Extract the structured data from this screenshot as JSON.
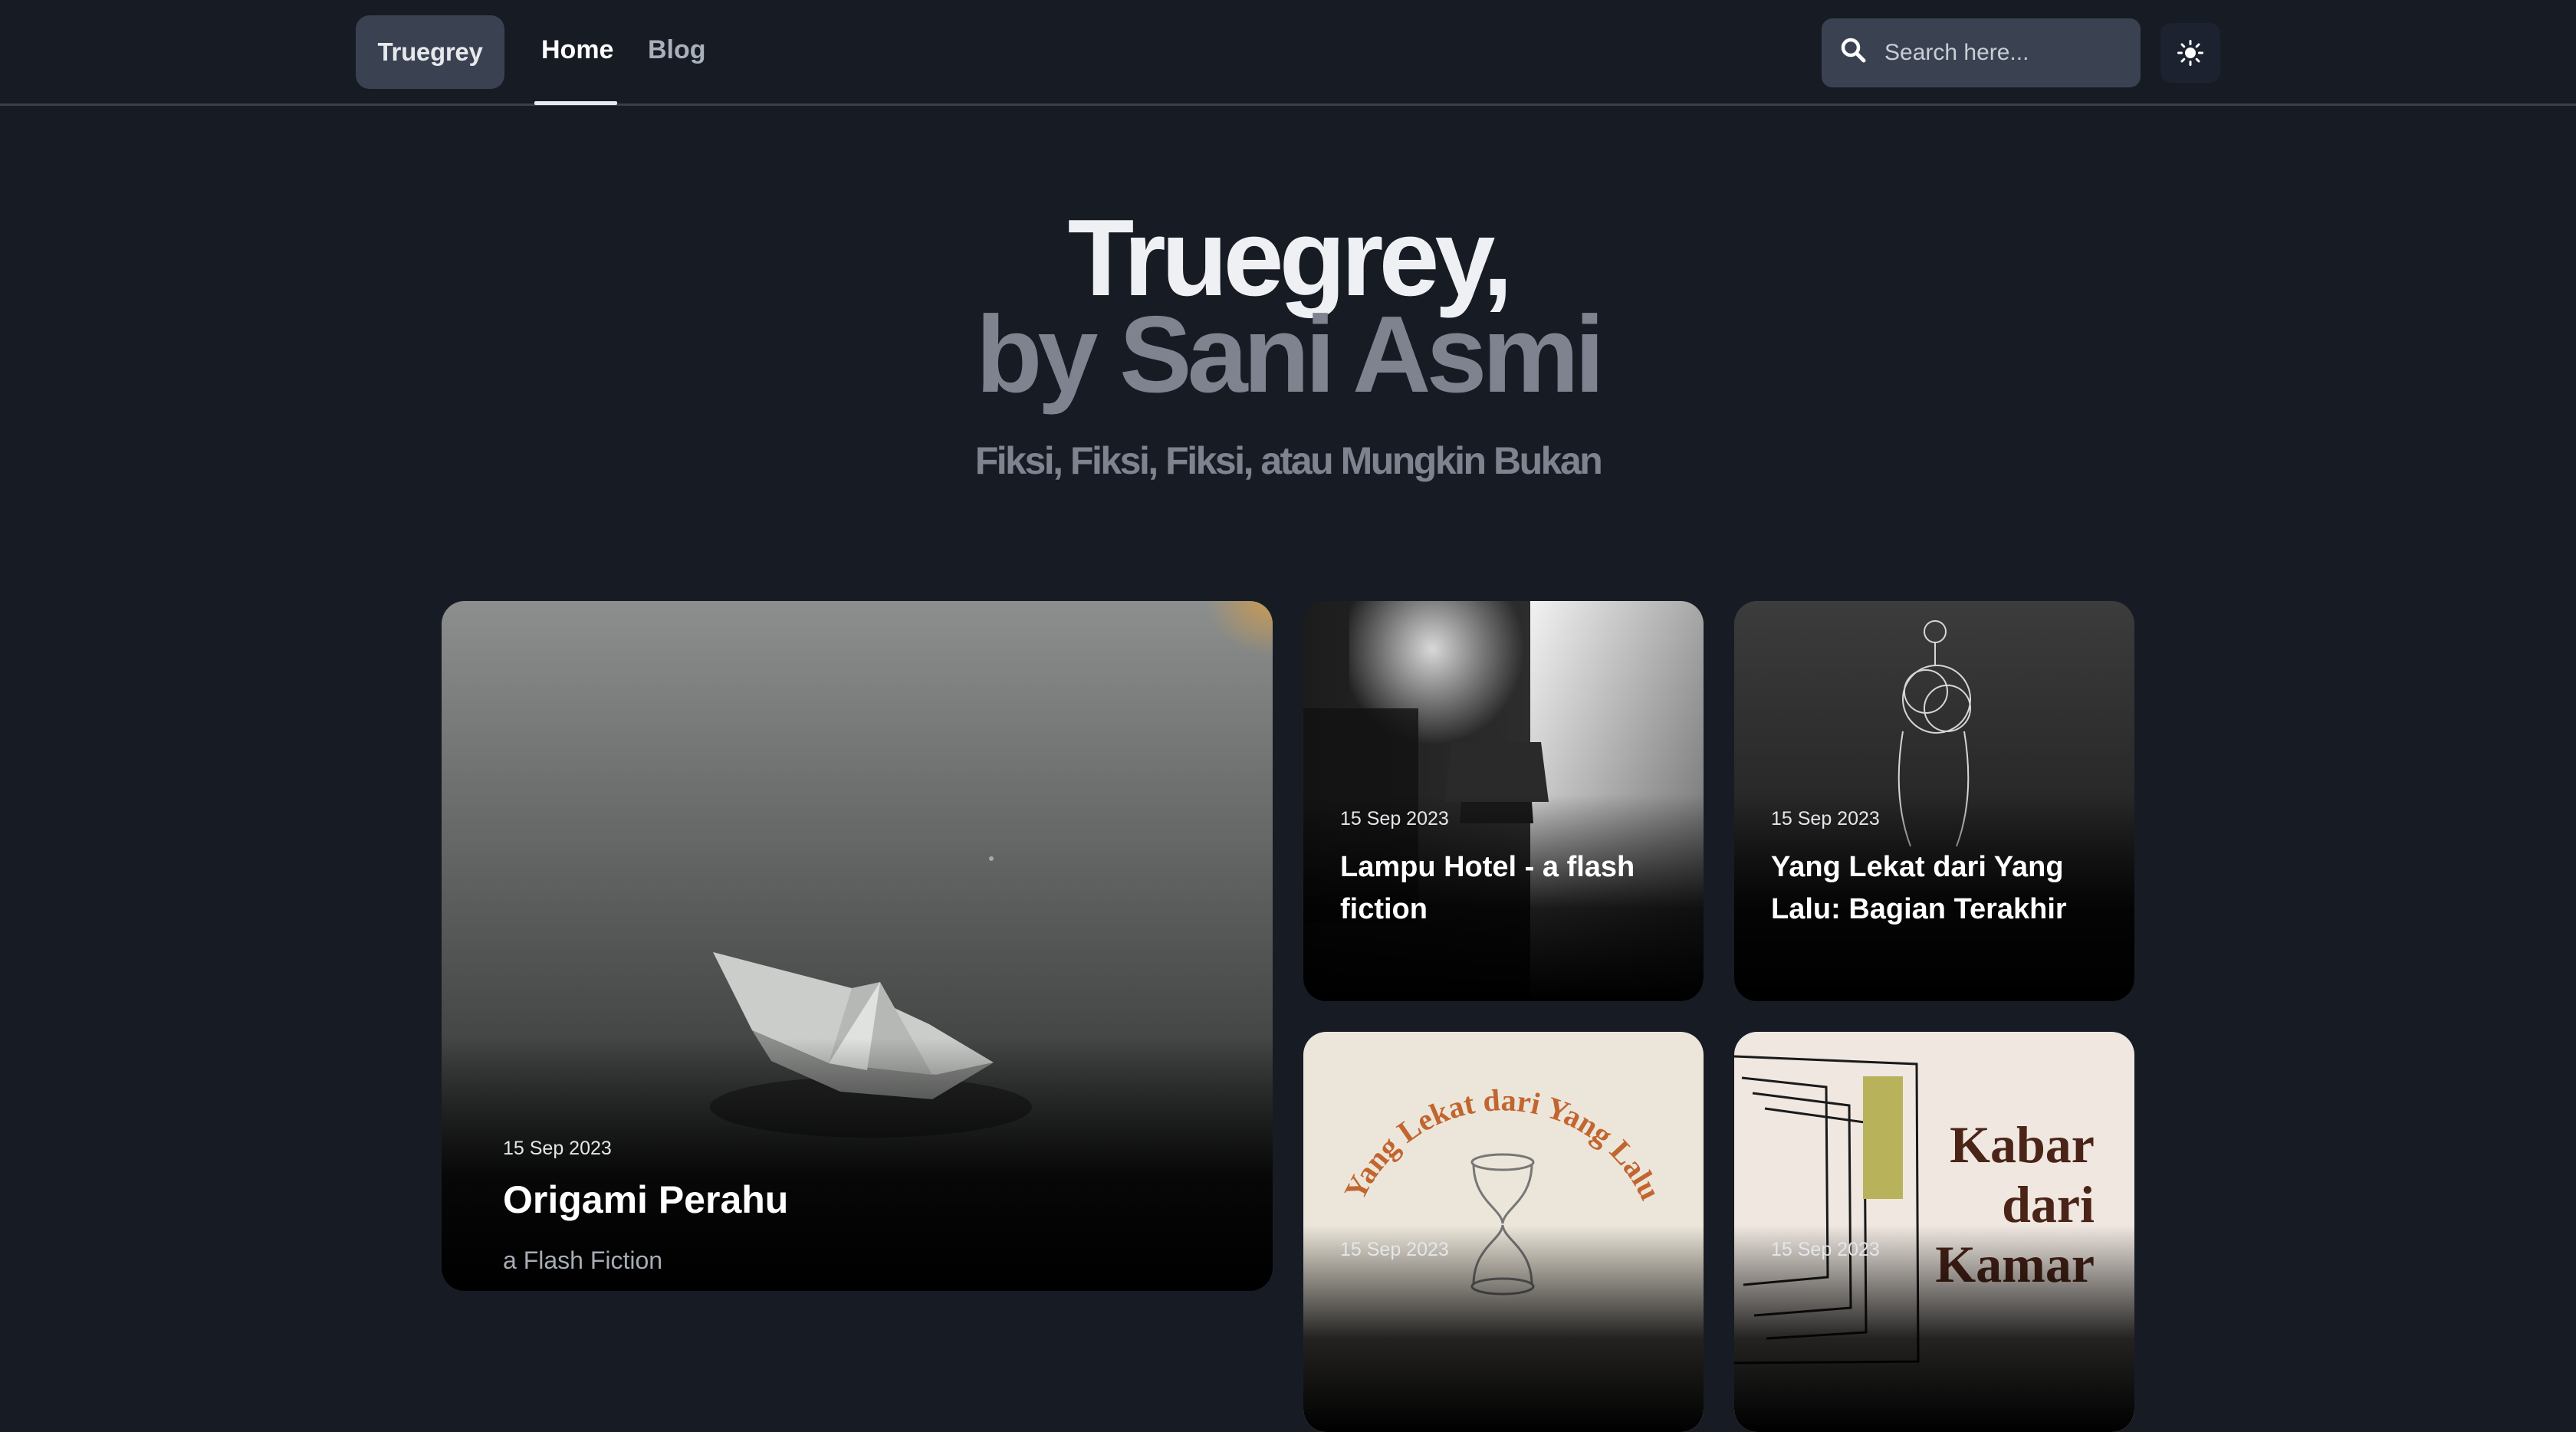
{
  "header": {
    "brand": "Truegrey",
    "nav": [
      {
        "label": "Home",
        "active": true
      },
      {
        "label": "Blog",
        "active": false
      }
    ],
    "search_placeholder": "Search here...",
    "icons": {
      "search": "search-icon",
      "theme": "sun-icon"
    }
  },
  "hero": {
    "title_line1": "Truegrey,",
    "title_line2": "by Sani Asmi",
    "subtitle": "Fiksi, Fiksi, Fiksi, atau Mungkin Bukan"
  },
  "posts": [
    {
      "date": "15 Sep 2023",
      "title": "Origami Perahu",
      "subtitle": "a Flash Fiction"
    },
    {
      "date": "15 Sep 2023",
      "title": "Lampu Hotel - a flash fiction"
    },
    {
      "date": "15 Sep 2023",
      "title": "Yang Lekat dari Yang Lalu: Bagian Terakhir"
    },
    {
      "date": "15 Sep 2023",
      "cover_text": "Yang Lekat dari Yang Lalu"
    },
    {
      "date": "15 Sep 2023",
      "cover_text": "Kabar dari Kamar"
    }
  ],
  "colors": {
    "background": "#171c24",
    "surface": "#3a4252",
    "muted_text": "#7e838f",
    "cover_orange": "#c2652f",
    "cover_brown": "#4b2418"
  }
}
